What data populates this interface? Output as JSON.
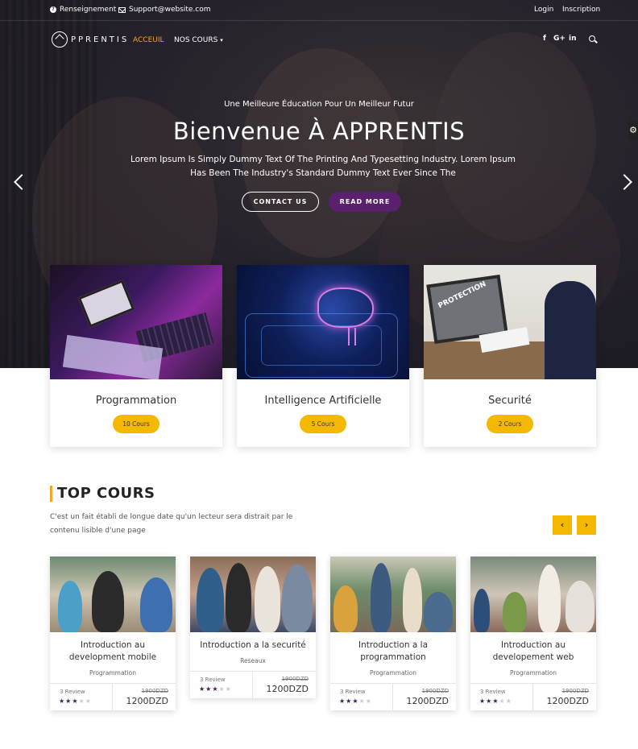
{
  "topbar": {
    "info_label": "Renseignement",
    "email": "Support@website.com",
    "login": "Login",
    "signup": "Inscription"
  },
  "nav": {
    "logo_text": "PPRENTIS",
    "home": "ACCEUIL",
    "courses": "NOS COURS",
    "social": [
      "f",
      "G+",
      "in"
    ]
  },
  "hero": {
    "subtitle": "Une Meilleure Éducation Pour Un Meilleur Futur",
    "title": "Bienvenue À APPRENTIS",
    "text": "Lorem Ipsum Is Simply Dummy Text Of The Printing And Typesetting Industry. Lorem Ipsum Has Been The Industry's Standard Dummy Text Ever Since The",
    "contact_btn": "CONTACT US",
    "read_btn": "READ MORE"
  },
  "categories": [
    {
      "title": "Programmation",
      "count": "10 Cours"
    },
    {
      "title": "Intelligence Artificielle",
      "count": "5 Cours"
    },
    {
      "title": "Securité",
      "count": "2 Cours"
    }
  ],
  "top": {
    "title": "TOP COURS",
    "description": "C'est un fait établi de longue date qu'un lecteur sera distrait par le contenu lisible d'une page",
    "prev": "‹",
    "next": "›"
  },
  "courses": [
    {
      "title": "Introduction au development mobile",
      "category": "Programmation",
      "reviews": "3 Review",
      "old_price": "1900DZD",
      "price": "1200DZD",
      "rating": 3
    },
    {
      "title": "Introduction a la securité",
      "category": "Reseaux",
      "reviews": "3 Review",
      "old_price": "1900DZD",
      "price": "1200DZD",
      "rating": 3
    },
    {
      "title": "Introduction a la programmation",
      "category": "Programmation",
      "reviews": "3 Review",
      "old_price": "1900DZD",
      "price": "1200DZD",
      "rating": 3
    },
    {
      "title": "Introduction au developement web",
      "category": "Programmation",
      "reviews": "3 Review",
      "old_price": "1900DZD",
      "price": "1200DZD",
      "rating": 3
    }
  ],
  "colors": {
    "accent": "#f5a623",
    "badge": "#f5b800",
    "primary_button": "#5a1f6d",
    "star": "#3d1a5b"
  },
  "icons": {
    "slider_prev": "chevron-left-icon",
    "slider_next": "chevron-right-icon",
    "search": "search-icon",
    "settings": "gear-icon"
  }
}
